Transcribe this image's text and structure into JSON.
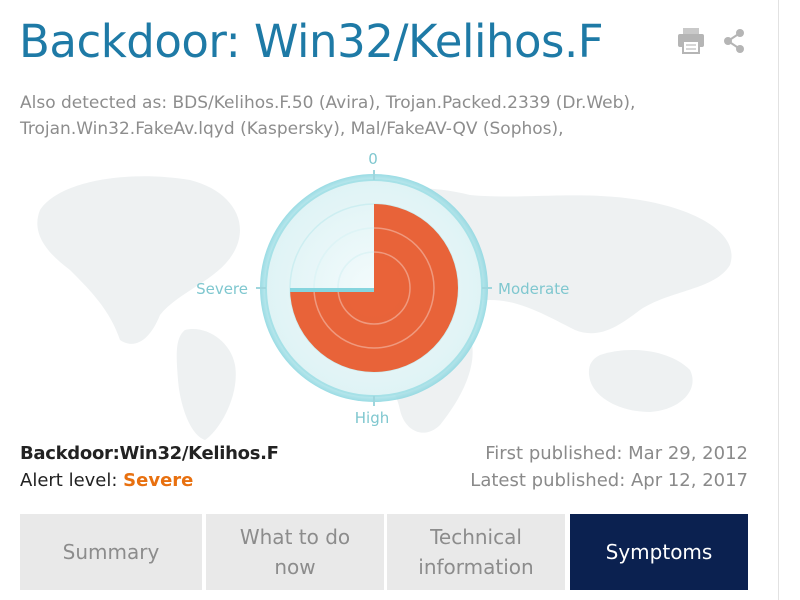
{
  "page": {
    "title": "Backdoor: Win32/Kelihos.F",
    "also_detected": "Also detected as: BDS/Kelihos.F.50 (Avira), Trojan.Packed.2339 (Dr.Web), Trojan.Win32.FakeAv.lqyd (Kaspersky), Mal/FakeAV-QV (Sophos),"
  },
  "icons": {
    "print": "printer-icon",
    "share": "share-icon"
  },
  "severity_gauge": {
    "labels": {
      "top": "0",
      "right": "Moderate",
      "bottom": "High",
      "left": "Severe"
    },
    "level": "Severe",
    "fill_fraction": 0.75,
    "fill_color": "#e85b2e"
  },
  "threat": {
    "name": "Backdoor:Win32/Kelihos.F",
    "alert_label": "Alert level: ",
    "alert_value": "Severe",
    "alert_color": "#e8700f",
    "first_published": "First published: Mar 29, 2012",
    "latest_published": "Latest published: Apr 12, 2017"
  },
  "tabs": [
    {
      "label": "Summary",
      "active": false
    },
    {
      "label": "What to do now",
      "active": false
    },
    {
      "label": "Technical information",
      "active": false
    },
    {
      "label": "Symptoms",
      "active": true
    }
  ]
}
